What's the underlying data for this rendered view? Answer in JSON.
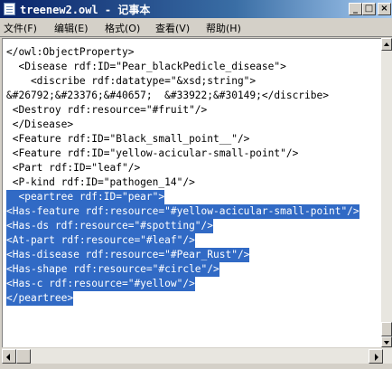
{
  "window": {
    "title": "treenew2.owl - 记事本",
    "minimize_glyph": "_",
    "maximize_glyph": "□",
    "close_glyph": "×"
  },
  "menu": [
    {
      "label": "文件(F)"
    },
    {
      "label": "编辑(E)"
    },
    {
      "label": "格式(O)"
    },
    {
      "label": "查看(V)"
    },
    {
      "label": "帮助(H)"
    }
  ],
  "editor": {
    "selection_color": "#316ac5",
    "lines": [
      {
        "text": "</owl:ObjectProperty>",
        "selected": false
      },
      {
        "text": "  <Disease rdf:ID=\"Pear_blackPedicle_disease\">",
        "selected": false
      },
      {
        "text": "    <discribe rdf:datatype=\"&xsd;string\">",
        "selected": false
      },
      {
        "text": "&#26792;&#23376;&#40657;  &#33922;&#30149;</discribe>",
        "selected": false
      },
      {
        "text": " <Destroy rdf:resource=\"#fruit\"/>",
        "selected": false
      },
      {
        "text": " </Disease>",
        "selected": false
      },
      {
        "text": " <Feature rdf:ID=\"Black_small_point__\"/>",
        "selected": false
      },
      {
        "text": " <Feature rdf:ID=\"yellow-acicular-small-point\"/>",
        "selected": false
      },
      {
        "text": " <Part rdf:ID=\"leaf\"/>",
        "selected": false
      },
      {
        "text": " <P-kind rdf:ID=\"pathogen_14\"/>",
        "selected": false
      },
      {
        "text": "  <peartree rdf:ID=\"pear\">",
        "selected": true
      },
      {
        "text": "<Has-feature rdf:resource=\"#yellow-acicular-small-point\"/>",
        "selected": true
      },
      {
        "text": "<Has-ds rdf:resource=\"#spotting\"/>",
        "selected": true
      },
      {
        "text": "<At-part rdf:resource=\"#leaf\"/>",
        "selected": true
      },
      {
        "text": "<Has-disease rdf:resource=\"#Pear_Rust\"/>",
        "selected": true
      },
      {
        "text": "<Has-shape rdf:resource=\"#circle\"/>",
        "selected": true
      },
      {
        "text": "<Has-c rdf:resource=\"#yellow\"/>",
        "selected": true
      },
      {
        "text": "</peartree>",
        "selected": true
      }
    ]
  }
}
